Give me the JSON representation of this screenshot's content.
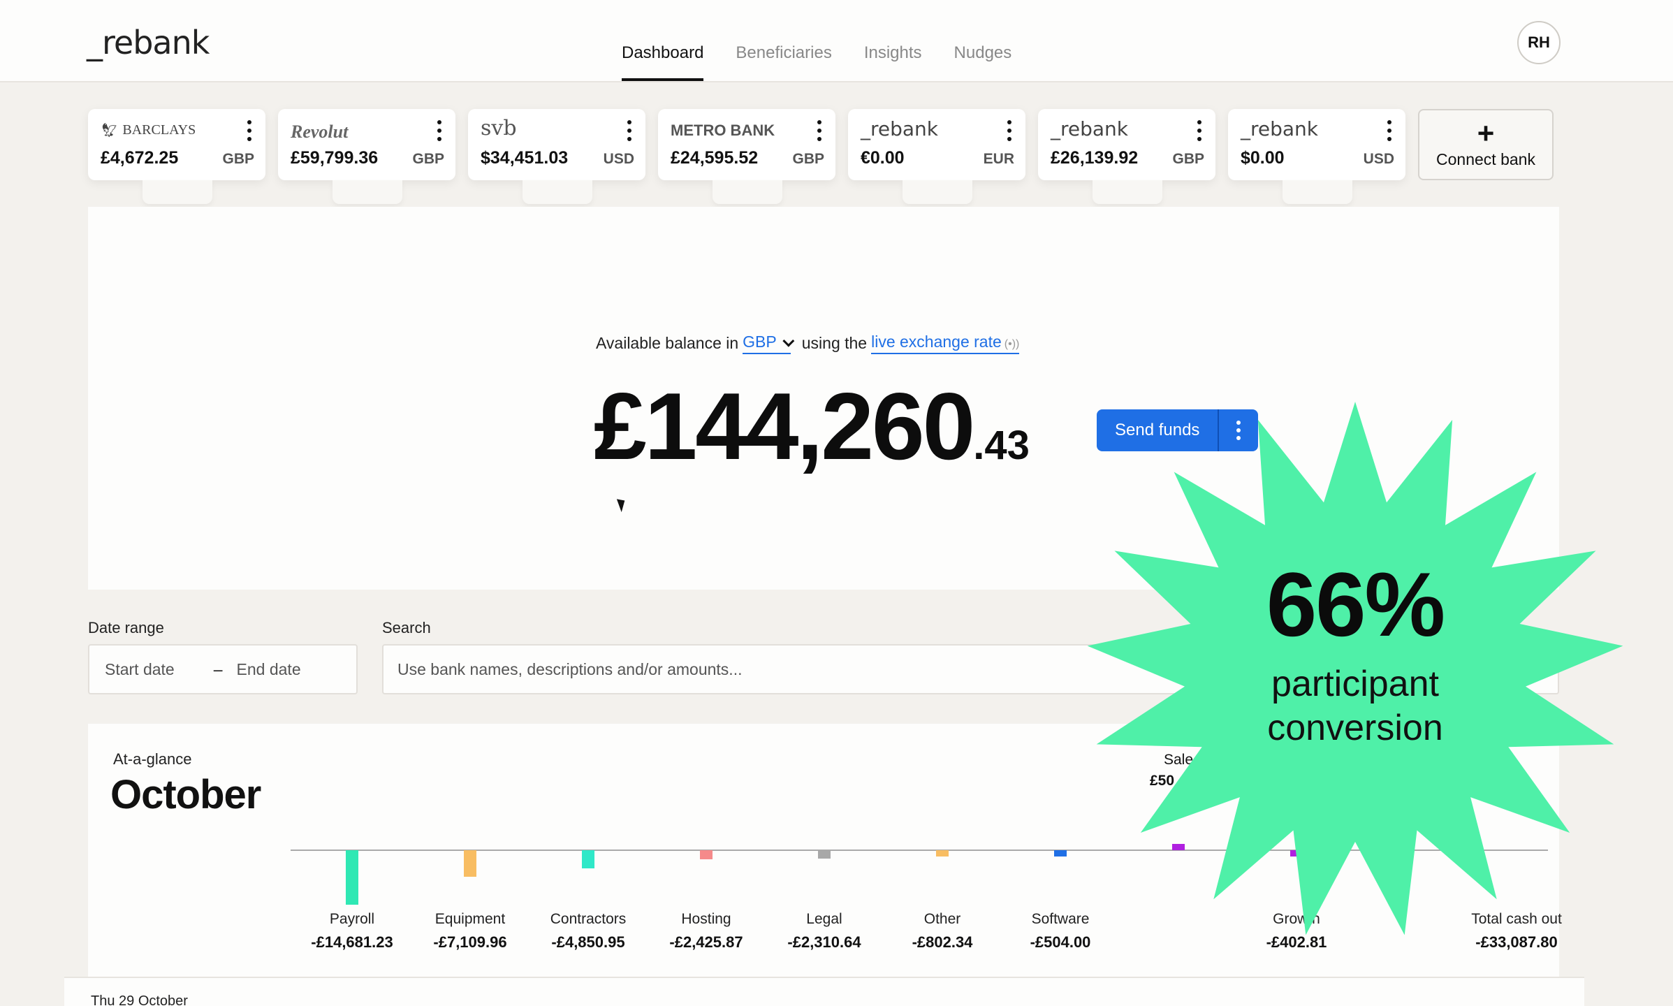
{
  "app": {
    "logo": "_rebank"
  },
  "nav": {
    "items": [
      "Dashboard",
      "Beneficiaries",
      "Insights",
      "Nudges"
    ],
    "active": "Dashboard"
  },
  "user": {
    "initials": "RH"
  },
  "accounts": [
    {
      "bank": "BARCLAYS",
      "amount": "£4,672.25",
      "currency": "GBP"
    },
    {
      "bank": "Revolut",
      "amount": "£59,799.36",
      "currency": "GBP"
    },
    {
      "bank": "svb",
      "amount": "$34,451.03",
      "currency": "USD"
    },
    {
      "bank": "METRO BANK",
      "amount": "£24,595.52",
      "currency": "GBP"
    },
    {
      "bank": "_rebank",
      "amount": "€0.00",
      "currency": "EUR"
    },
    {
      "bank": "_rebank",
      "amount": "£26,139.92",
      "currency": "GBP"
    },
    {
      "bank": "_rebank",
      "amount": "$0.00",
      "currency": "USD"
    }
  ],
  "connect_bank": {
    "plus": "+",
    "label": "Connect bank"
  },
  "balance": {
    "prefix": "Available balance in",
    "currency": "GBP",
    "middle": "using the",
    "rate_link": "live exchange rate",
    "main": "£144,260",
    "cents": ".43",
    "send_label": "Send funds"
  },
  "filters": {
    "date_label": "Date range",
    "start_placeholder": "Start date",
    "dash": "–",
    "end_placeholder": "End date",
    "search_label": "Search",
    "search_placeholder": "Use bank names, descriptions and/or amounts..."
  },
  "glance": {
    "subtitle": "At-a-glance",
    "month": "October",
    "sales_label": "Sale",
    "sales_value": "£50"
  },
  "chart_data": {
    "type": "bar",
    "categories": [
      "Payroll",
      "Equipment",
      "Contractors",
      "Hosting",
      "Legal",
      "Other",
      "Software",
      "",
      "Growth"
    ],
    "values": [
      -14681.23,
      -7109.96,
      -4850.95,
      -2425.87,
      -2310.64,
      -802.34,
      -504.0,
      0,
      -402.81
    ],
    "value_labels": [
      "-£14,681.23",
      "-£7,109.96",
      "-£4,850.95",
      "-£2,425.87",
      "-£2,310.64",
      "-£802.34",
      "-£504.00",
      "",
      "-£402.81"
    ],
    "colors": [
      "#2fe8b4",
      "#f8bd62",
      "#2fe8c8",
      "#f58a8a",
      "#a8a8a8",
      "#f8bd62",
      "#1f6fe5",
      "#b020e0",
      "#b020e0"
    ],
    "total_label": "Total cash out",
    "total_value": "-£33,087.80"
  },
  "date_strip": "Thu 29 October",
  "overlay": {
    "percent": "66%",
    "line1": "participant",
    "line2": "conversion",
    "color": "#4ff0a8"
  }
}
